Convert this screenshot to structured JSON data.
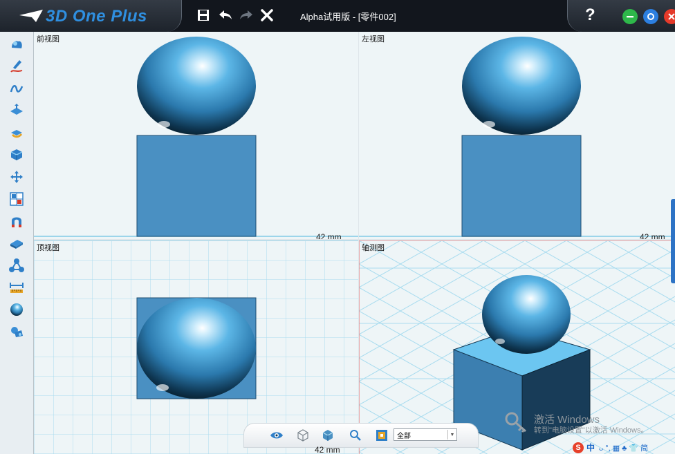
{
  "app": {
    "logo_text": "3D One Plus",
    "title": "Alpha试用版 - [零件002]"
  },
  "titlebar": {
    "save_icon": "save-icon",
    "undo_icon": "undo-icon",
    "redo_icon": "redo-icon",
    "close_doc_icon": "close-icon",
    "help_label": "?",
    "window_buttons": [
      {
        "name": "minimize-button",
        "color": "#2eb84a"
      },
      {
        "name": "maximize-button",
        "color": "#2c7fe0"
      },
      {
        "name": "close-button",
        "color": "#e53a2a"
      }
    ]
  },
  "toolbar": {
    "tools": [
      "basic-solid-icon",
      "sketch-draw-icon",
      "curve-icon",
      "feature-icon",
      "special-feature-icon",
      "combine-icon",
      "move-icon",
      "array-icon",
      "magnet-icon",
      "cut-plane-icon",
      "assembly-icon",
      "measure-icon",
      "material-sphere-icon",
      "component-library-icon"
    ]
  },
  "viewports": [
    {
      "label": "前视图",
      "scale": "42 mm"
    },
    {
      "label": "左视图",
      "scale": "42 mm"
    },
    {
      "label": "顶视图",
      "scale": "42 mm"
    },
    {
      "label": "轴测图",
      "scale": ""
    }
  ],
  "bottom_bar": {
    "icons": [
      "view-eye-icon",
      "wireframe-cube-icon",
      "solid-cube-icon",
      "search-zoom-icon",
      "layer-filter-icon"
    ],
    "filter_value": "全部"
  },
  "watermark": {
    "line1": "激活 Windows",
    "line2": "转到\"电脑设置\"以激活 Windows。"
  },
  "ime": {
    "logo": "S",
    "lang": "中",
    "symbols": "ᴗ °, ▦ ♣ 👕 简"
  },
  "colors": {
    "accent": "#2f8fe0",
    "model_blue": "#4a90c2",
    "grid_line": "#9cd5ea",
    "viewport_bg": "#eef5f7"
  }
}
